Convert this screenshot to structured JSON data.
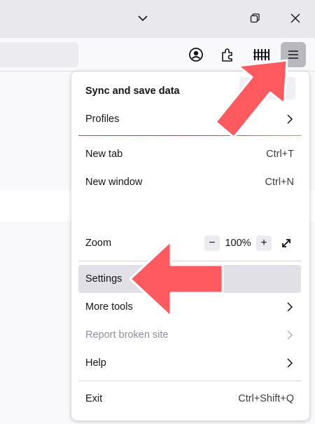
{
  "menu": {
    "sync_label": "Sync and save data",
    "profiles_label": "Profiles",
    "new_tab_label": "New tab",
    "new_tab_shortcut": "Ctrl+T",
    "new_window_label": "New window",
    "new_window_shortcut": "Ctrl+N",
    "zoom_label": "Zoom",
    "zoom_value": "100%",
    "zoom_out": "−",
    "zoom_in": "+",
    "settings_label": "Settings",
    "more_tools_label": "More tools",
    "report_label": "Report broken site",
    "help_label": "Help",
    "exit_label": "Exit",
    "exit_shortcut": "Ctrl+Shift+Q"
  },
  "colors": {
    "arrow": "#ff5a5f",
    "menu_hover": "#e0e0e6",
    "active_button": "#b8b8be"
  },
  "icons": [
    "chevron-down-icon",
    "restore-icon",
    "close-icon",
    "account-icon",
    "extensions-icon",
    "library-icon",
    "hamburger-menu-icon",
    "chevron-right-icon",
    "fullscreen-icon"
  ]
}
